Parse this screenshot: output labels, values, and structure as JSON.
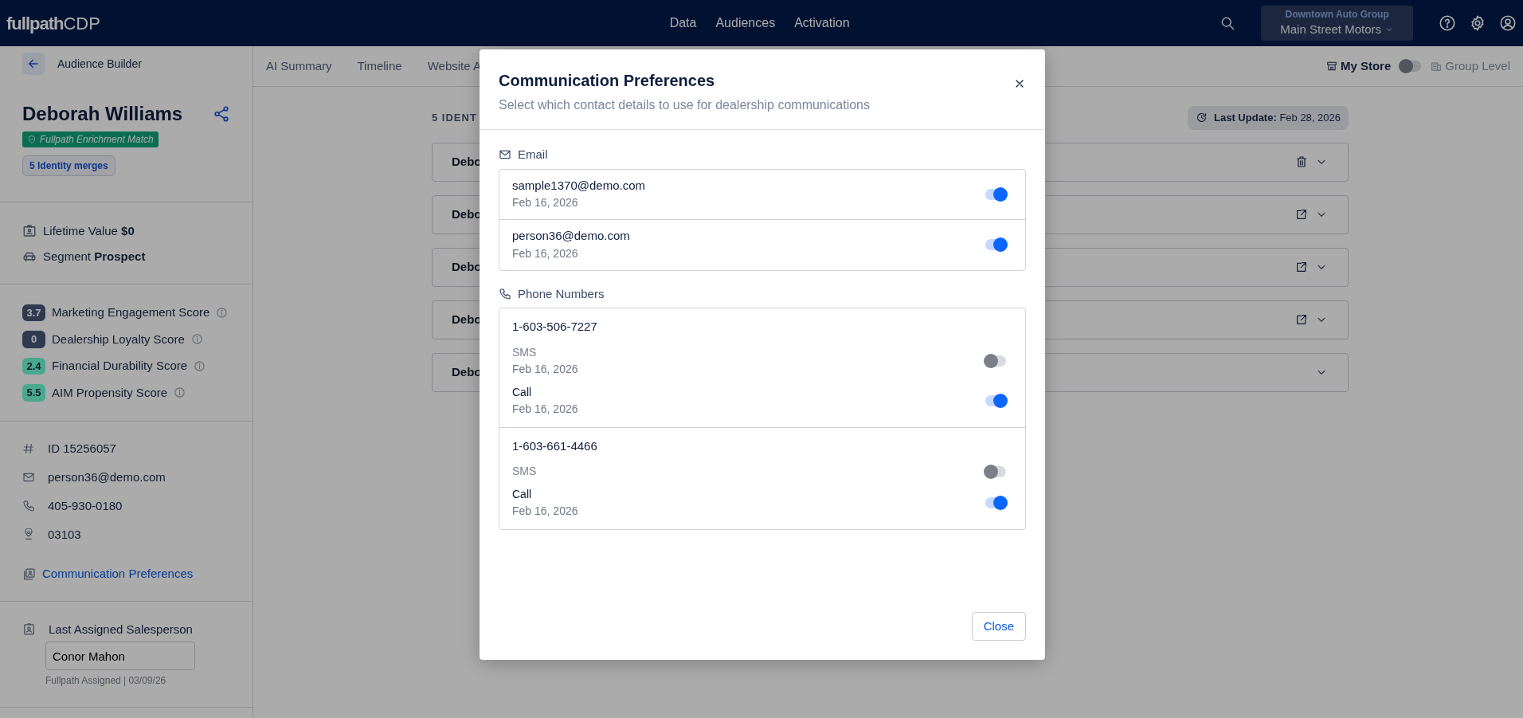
{
  "navbar": {
    "logo_main": "fullpath",
    "logo_suffix": "CDP",
    "menu": [
      "Data",
      "Audiences",
      "Activation"
    ],
    "store_selector": {
      "group": "Downtown Auto Group",
      "store": "Main Street Motors"
    }
  },
  "sidebar": {
    "back_label": "Audience Builder",
    "name": "Deborah Williams",
    "match_badge": "Fullpath Enrichment Match",
    "merges": "5 Identity merges",
    "stats": [
      {
        "kind": "value",
        "text": "Lifetime Value **$0**"
      },
      {
        "kind": "segment",
        "text": "Segment **Prospect**"
      }
    ],
    "scores": [
      {
        "value": "3.7",
        "label": "Marketing Engagement Score",
        "color": "#2f3a52",
        "kind": "dark"
      },
      {
        "value": "0",
        "label": "Dealership Loyalty Score",
        "color": "#2f3a52",
        "kind": "dark"
      },
      {
        "value": "2.4",
        "label": "Financial Durability Score",
        "color": "#4aa88e",
        "kind": "light"
      },
      {
        "value": "5.5",
        "label": "AIM Propensity Score",
        "color": "#4aa88e",
        "kind": "light"
      }
    ],
    "details": [
      {
        "kind": "id",
        "text": "ID 15256057"
      },
      {
        "kind": "email",
        "text": "person36@demo.com"
      },
      {
        "kind": "phone",
        "text": "405-930-0180"
      },
      {
        "kind": "location",
        "text": "03103"
      }
    ],
    "preferences_link": "Communication Preferences",
    "salesperson": {
      "label": "Last Assigned Salesperson",
      "value": "Conor Mahon",
      "note": "Fullpath Assigned | 03/09/26"
    }
  },
  "tabs": [
    {
      "label": "AI Summary",
      "selected": false
    },
    {
      "label": "Timeline",
      "selected": false
    },
    {
      "label": "Website A",
      "selected": false
    }
  ],
  "scope": {
    "store_label": "My Store",
    "group_label": "Group Level",
    "group_level": false
  },
  "identities": {
    "heading": "5 IDENT",
    "last_update": "**Last Update:** Feb 28, 2026",
    "cards": [
      {
        "name": "Debo",
        "kind": "delete"
      },
      {
        "name": "Debo",
        "kind": "open"
      },
      {
        "name": "Debo",
        "kind": "open"
      },
      {
        "name": "Debo",
        "kind": "open"
      },
      {
        "name": "Debo",
        "kind": "plain"
      }
    ]
  },
  "modal": {
    "title": "Communication Preferences",
    "subtitle": "Select which contact details to use for dealership communications",
    "email_label": "Email",
    "emails": [
      {
        "address": "sample1370@demo.com",
        "date": "Feb 16, 2026",
        "on": true
      },
      {
        "address": "person36@demo.com",
        "date": "Feb 16, 2026",
        "on": true
      }
    ],
    "phone_label": "Phone Numbers",
    "phones": [
      {
        "number": "1-603-506-7227",
        "channels": [
          {
            "label": "SMS",
            "date": "Feb 16, 2026",
            "on": false
          },
          {
            "label": "Call",
            "date": "Feb 16, 2026",
            "on": true
          }
        ]
      },
      {
        "number": "1-603-661-4466",
        "channels": [
          {
            "label": "SMS",
            "on": false
          },
          {
            "label": "Call",
            "date": "Feb 16, 2026",
            "on": true
          }
        ]
      }
    ],
    "close_button": "Close"
  }
}
